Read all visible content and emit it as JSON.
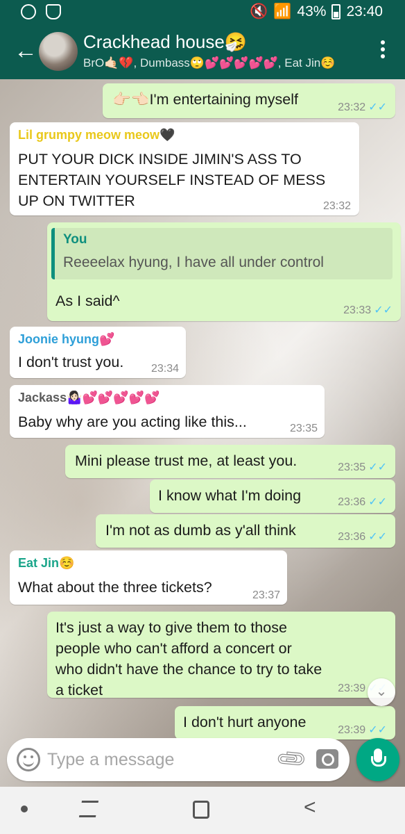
{
  "status_bar": {
    "battery": "43%",
    "time": "23:40"
  },
  "header": {
    "title": "Crackhead house🤧",
    "participants": "BrO🤙🏻💔, Dumbass🙄💕💕💕💕💕, Eat Jin☺️"
  },
  "messages": [
    {
      "direction": "out",
      "text": "👉🏻👈🏻I'm entertaining myself",
      "time": "23:32",
      "ticks": "✓✓"
    },
    {
      "direction": "in",
      "sender": "Lil grumpy meow meow🖤",
      "sender_color": "#e9c81b",
      "text": "PUT YOUR DICK INSIDE JIMIN'S ASS TO\nENTERTAIN YOURSELF INSTEAD OF MESS\nUP ON TWITTER",
      "time": "23:32"
    },
    {
      "direction": "out",
      "quote_name": "You",
      "quote_text": "Reeeelax hyung, I have all under control",
      "text": "As I said^",
      "time": "23:33",
      "ticks": "✓✓"
    },
    {
      "direction": "in",
      "sender": "Joonie hyung💕",
      "sender_color": "#2e9fd8",
      "text": "I don't trust you.",
      "time": "23:34"
    },
    {
      "direction": "in",
      "sender": "Jackass🤷🏻‍♀️💕💕💕💕💕",
      "sender_color": "#5b5b5b",
      "text": "Baby why are you acting like this...",
      "time": "23:35"
    },
    {
      "direction": "out",
      "text": "Mini please trust me, at least you.",
      "time": "23:35",
      "ticks": "✓✓"
    },
    {
      "direction": "out",
      "text": "I know what I'm doing",
      "time": "23:36",
      "ticks": "✓✓"
    },
    {
      "direction": "out",
      "text": "I'm not as dumb as y'all think",
      "time": "23:36",
      "ticks": "✓✓"
    },
    {
      "direction": "in",
      "sender": "Eat Jin☺️",
      "sender_color": "#1aa58a",
      "text": "What about the three tickets?",
      "time": "23:37"
    },
    {
      "direction": "out",
      "text": "It's just a way to give them to those\npeople who can't afford a concert or\nwho didn't have the chance to try to take\na ticket",
      "time": "23:39",
      "ticks": "✓✓"
    },
    {
      "direction": "out",
      "text": "I don't hurt anyone",
      "time": "23:39",
      "ticks": "✓✓"
    }
  ],
  "input": {
    "placeholder": "Type a message"
  },
  "icons": {
    "back": "back-arrow-icon",
    "menu": "more-vert-icon",
    "emoji": "emoji-icon",
    "attach": "paperclip-icon",
    "camera": "camera-icon",
    "mic": "microphone-icon",
    "scroll": "chevron-double-down-icon"
  },
  "colors": {
    "header": "#0c5b4f",
    "outgoing_bubble": "#dcf8c6",
    "incoming_bubble": "#ffffff",
    "read_ticks": "#4fc3f7",
    "mic_button": "#00a884"
  }
}
